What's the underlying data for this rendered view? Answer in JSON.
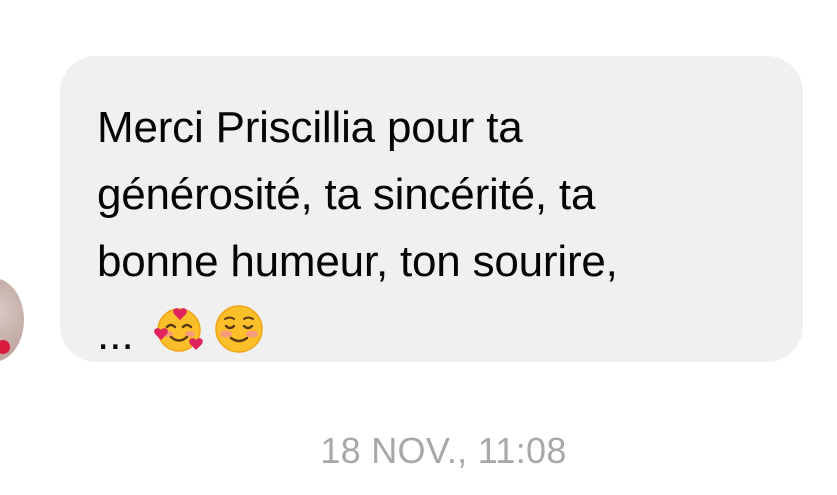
{
  "message": {
    "lines": [
      "Merci Priscillia pour ta",
      "générosité, ta sincérité, ta",
      "bonne humeur, ton sourire,"
    ],
    "ellipsis": "...",
    "emojis": [
      "smiling-face-with-hearts-icon",
      "smiling-face-icon"
    ]
  },
  "timestamp": "18 NOV., 11:08",
  "colors": {
    "bubble": "#f0f0f0",
    "text": "#050505",
    "timestamp": "#a8a8a8"
  }
}
